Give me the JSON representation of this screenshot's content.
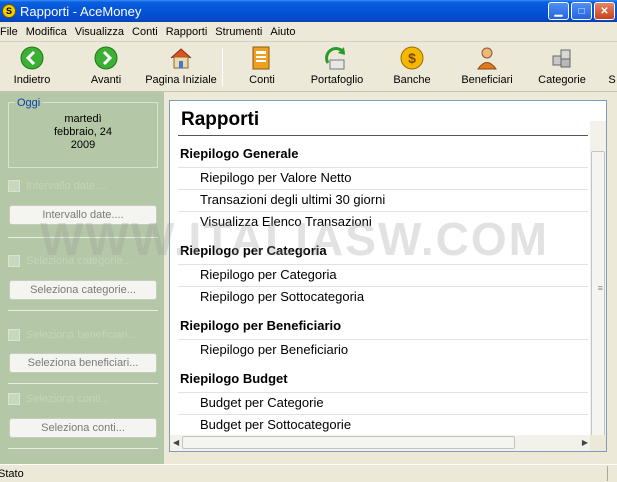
{
  "window": {
    "title": "Rapporti - AceMoney",
    "icon": "S"
  },
  "menu": [
    "File",
    "Modifica",
    "Visualizza",
    "Conti",
    "Rapporti",
    "Strumenti",
    "Aiuto"
  ],
  "toolbar": {
    "back": "Indietro",
    "forward": "Avanti",
    "home": "Pagina Iniziale",
    "accounts": "Conti",
    "portfolio": "Portafoglio",
    "banks": "Banche",
    "payees": "Beneficiari",
    "categories": "Categorie",
    "more": "S"
  },
  "left_panel": {
    "today_caption": "Oggi",
    "today_weekday": "martedì",
    "today_date": "febbraio, 24",
    "today_year": "2009",
    "filters": [
      {
        "label": "Intervallo date....",
        "button": "Intervallo date....",
        "checked": false
      },
      {
        "label": "Seleziona categorie...",
        "button": "Seleziona categorie...",
        "checked": false
      },
      {
        "label": "Seleziona beneficiari...",
        "button": "Seleziona beneficiari...",
        "checked": false
      },
      {
        "label": "Seleziona conti...",
        "button": "Seleziona conti...",
        "checked": false
      }
    ]
  },
  "report": {
    "title": "Rapporti",
    "sections": [
      {
        "heading": "Riepilogo Generale",
        "items": [
          "Riepilogo per Valore Netto",
          "Transazioni degli ultimi 30 giorni",
          "Visualizza Elenco Transazioni"
        ]
      },
      {
        "heading": "Riepilogo per Categoria",
        "items": [
          "Riepilogo per Categoria",
          "Riepilogo per Sottocategoria"
        ]
      },
      {
        "heading": "Riepilogo per Beneficiario",
        "items": [
          "Riepilogo per Beneficiario"
        ]
      },
      {
        "heading": "Riepilogo Budget",
        "items": [
          "Budget per Categorie",
          "Budget per Sottocategorie"
        ]
      }
    ]
  },
  "watermark": "WWW.ITALIASW.COM",
  "status": {
    "text": "Stato"
  },
  "colors": {
    "titlebar": "#0453d8",
    "left_panel": "#b4c8a8",
    "today_caption": "#0a3fa8",
    "window_bg": "#ece9d8"
  }
}
